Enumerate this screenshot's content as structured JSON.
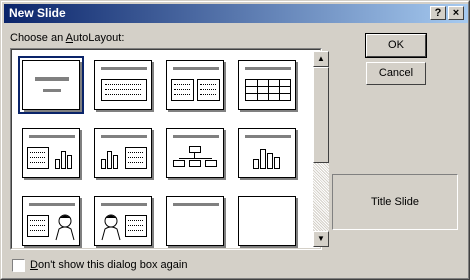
{
  "window": {
    "title": "New Slide",
    "help_btn": "?",
    "close_btn": "×"
  },
  "layout_label": {
    "pre": "Choose an ",
    "underlined": "A",
    "post": "utoLayout:"
  },
  "buttons": {
    "ok": "OK",
    "cancel": "Cancel"
  },
  "preview": {
    "name": "Title Slide"
  },
  "checkbox": {
    "underlined": "D",
    "post": "on't show this dialog box again",
    "checked": false
  },
  "layouts": [
    "title-slide",
    "bulleted-list",
    "two-column-text",
    "table",
    "text-and-chart",
    "chart-and-text",
    "organization-chart",
    "chart",
    "text-and-clip-art",
    "clip-art-and-text",
    "title-only",
    "blank"
  ],
  "selected_layout": "title-slide"
}
